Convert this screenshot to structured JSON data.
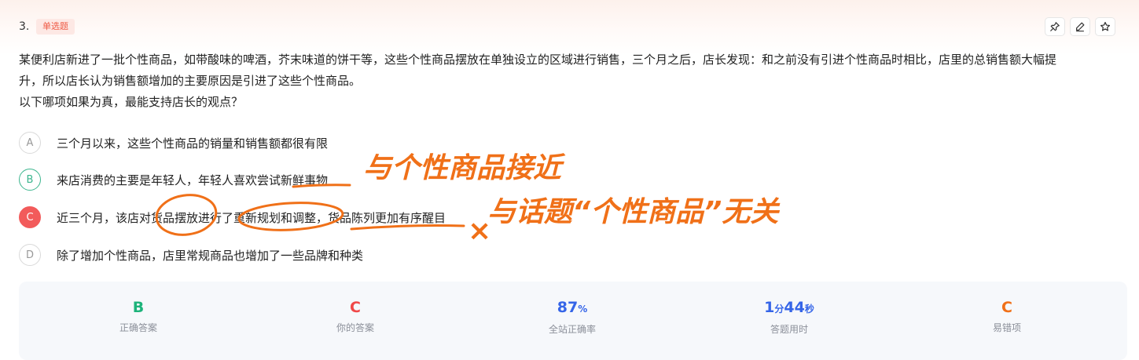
{
  "question": {
    "number": "3.",
    "type_tag": "单选题",
    "stem_lines": [
      "某便利店新进了一批个性商品，如带酸味的啤酒，芥末味道的饼干等，这些个性商品摆放在单独设立的区域进行销售，三个月之后，店长发现：和之前没有引进个性商品时相比，店里的总销售额大幅提",
      "升，所以店长认为销售额增加的主要原因是引进了这些个性商品。",
      "以下哪项如果为真，最能支持店长的观点？"
    ]
  },
  "toolbar": {
    "pin_icon": "pin-icon",
    "edit_icon": "pencil-icon",
    "favorite_icon": "star-icon"
  },
  "options": [
    {
      "letter": "A",
      "text": "三个月以来，这些个性商品的销量和销售额都很有限",
      "state": "normal"
    },
    {
      "letter": "B",
      "text": "来店消费的主要是年轻人，年轻人喜欢尝试新鲜事物",
      "state": "correct"
    },
    {
      "letter": "C",
      "text": "近三个月，该店对货品摆放进行了重新规划和调整，货品陈列更加有序醒目",
      "state": "wrong"
    },
    {
      "letter": "D",
      "text": "除了增加个性商品，店里常规商品也增加了一些品牌和种类",
      "state": "normal"
    }
  ],
  "handwritten_notes": {
    "note_b": "与个性商品接近",
    "note_c": "与话题“个性商品”无关",
    "cross_mark": "×"
  },
  "stats": {
    "correct_answer": {
      "value": "B",
      "label": "正确答案",
      "color": "#1db37a"
    },
    "your_answer": {
      "value": "C",
      "label": "你的答案",
      "color": "#f04848"
    },
    "accuracy": {
      "value": "87",
      "unit": "%",
      "label": "全站正确率",
      "color": "#3565e8"
    },
    "time": {
      "min": "1",
      "min_unit": "分",
      "sec": "44",
      "sec_unit": "秒",
      "label": "答题用时",
      "color": "#3565e8"
    },
    "common_wrong": {
      "value": "C",
      "label": "易错项",
      "color": "#f07018"
    }
  }
}
